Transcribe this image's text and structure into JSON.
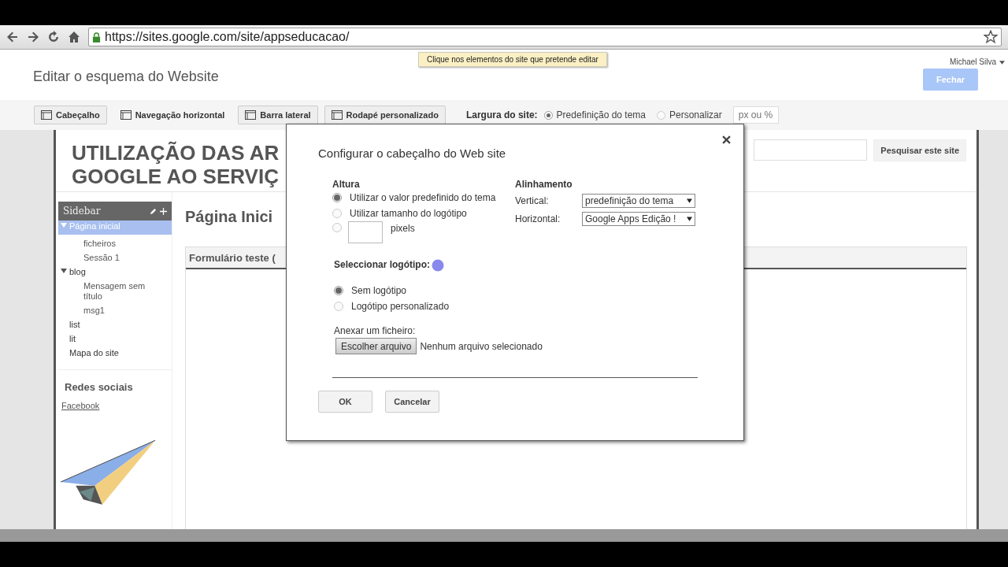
{
  "browser": {
    "url": "https://sites.google.com/site/appseducacao/"
  },
  "tooltip": "Clique nos elementos do site que pretende editar",
  "user": {
    "name": "Michael Silva"
  },
  "page_title": "Editar o esquema do Website",
  "close_button": {
    "label": "Fechar",
    "disabled": true
  },
  "layout_toolbar": {
    "items": [
      {
        "label": "Cabeçalho",
        "active": true
      },
      {
        "label": "Navegação horizontal",
        "active": false
      },
      {
        "label": "Barra lateral",
        "active": true
      },
      {
        "label": "Rodapé personalizado",
        "active": true
      }
    ],
    "width_label": "Largura do site:",
    "width_options": [
      {
        "label": "Predefinição do tema",
        "selected": true
      },
      {
        "label": "Personalizar",
        "selected": false
      }
    ],
    "width_placeholder": "px ou %"
  },
  "site": {
    "title_lines": [
      "UTILIZAÇÃO DAS AR",
      "GOOGLE AO SERVIÇ"
    ],
    "search_button": "Pesquisar este site",
    "sidebar": {
      "title": "Sidebar",
      "items": [
        {
          "label": "Página inicial",
          "selected": true,
          "expanded": true,
          "children": [
            {
              "label": "ficheiros",
              "selected": false
            },
            {
              "label": "Sessão 1",
              "selected": false
            }
          ]
        },
        {
          "label": "blog",
          "selected": false,
          "expanded": true,
          "children": [
            {
              "label": "Mensagem sem título",
              "selected": false
            },
            {
              "label": "msg1",
              "selected": false
            }
          ]
        },
        {
          "label": "list",
          "selected": false
        },
        {
          "label": "lit",
          "selected": false
        },
        {
          "label": "Mapa do site",
          "selected": false
        }
      ],
      "social_title": "Redes sociais",
      "social_link": "Facebook"
    },
    "page_heading": "Página Inici",
    "gadget_title": "Formulário teste ("
  },
  "dialog": {
    "title": "Configurar o cabeçalho do Web site",
    "height": {
      "label": "Altura",
      "options": [
        {
          "label": "Utilizar o valor predefinido do tema",
          "selected": true,
          "kind": "text"
        },
        {
          "label": "Utilizar tamanho do logótipo",
          "selected": false,
          "kind": "text"
        },
        {
          "label": "pixels",
          "selected": false,
          "kind": "input"
        }
      ]
    },
    "alignment": {
      "label": "Alinhamento",
      "fields": [
        {
          "label": "Vertical:",
          "value": "predefinição do tema"
        },
        {
          "label": "Horizontal:",
          "value": "Google Apps Edição !"
        }
      ]
    },
    "logo": {
      "label": "Seleccionar logótipo:",
      "options": [
        {
          "label": "Sem logótipo",
          "selected": true
        },
        {
          "label": "Logótipo personalizado",
          "selected": false
        }
      ]
    },
    "attach_label": "Anexar um ficheiro:",
    "file_button": "Escolher arquivo",
    "file_status": "Nenhum arquivo selecionado",
    "buttons": [
      "OK",
      "Cancelar"
    ]
  }
}
